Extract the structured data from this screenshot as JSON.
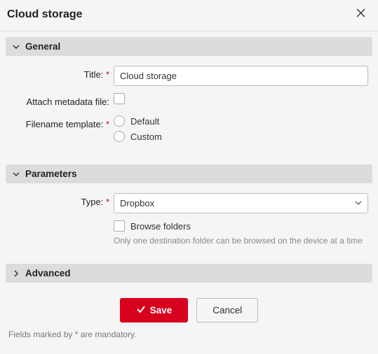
{
  "dialog": {
    "title": "Cloud storage"
  },
  "sections": {
    "general": {
      "heading": "General",
      "title_label": "Title:",
      "title_value": "Cloud storage",
      "attach_metadata_label": "Attach metadata file:",
      "filename_template_label": "Filename template:",
      "template_default": "Default",
      "template_custom": "Custom"
    },
    "parameters": {
      "heading": "Parameters",
      "type_label": "Type:",
      "type_value": "Dropbox",
      "browse_folders_label": "Browse folders",
      "browse_hint": "Only one destination folder can be browsed on the device at a time"
    },
    "advanced": {
      "heading": "Advanced"
    }
  },
  "actions": {
    "save": "Save",
    "cancel": "Cancel"
  },
  "footnote": "Fields marked by * are mandatory.",
  "required_marker": "*"
}
